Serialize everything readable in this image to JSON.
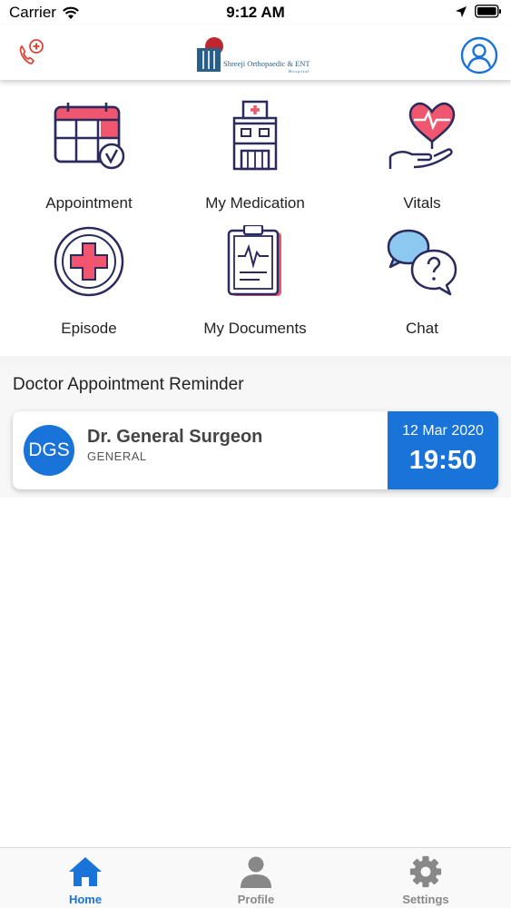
{
  "status_bar": {
    "carrier": "Carrier",
    "time": "9:12 AM"
  },
  "header": {
    "logo_text": "Shreeji Orthopaedic & ENT",
    "logo_subtext": "Hospital"
  },
  "menu": [
    {
      "label": "Appointment",
      "icon": "calendar-check-icon"
    },
    {
      "label": "My Medication",
      "icon": "hospital-building-icon"
    },
    {
      "label": "Vitals",
      "icon": "heart-hand-icon"
    },
    {
      "label": "Episode",
      "icon": "medical-cross-icon"
    },
    {
      "label": "My Documents",
      "icon": "clipboard-chart-icon"
    },
    {
      "label": "Chat",
      "icon": "chat-question-icon"
    }
  ],
  "reminder": {
    "title": "Doctor Appointment Reminder",
    "appointment": {
      "initials": "DGS",
      "doctor": "Dr. General Surgeon",
      "specialty": "GENERAL",
      "date": "12 Mar 2020",
      "time": "19:50"
    }
  },
  "tabs": [
    {
      "label": "Home",
      "icon": "home-icon",
      "active": true
    },
    {
      "label": "Profile",
      "icon": "person-icon",
      "active": false
    },
    {
      "label": "Settings",
      "icon": "gear-icon",
      "active": false
    }
  ],
  "colors": {
    "accent": "#1a73d9",
    "icon_stroke": "#2b2a5c",
    "icon_fill": "#f0566e",
    "call_icon": "#e0453a"
  }
}
